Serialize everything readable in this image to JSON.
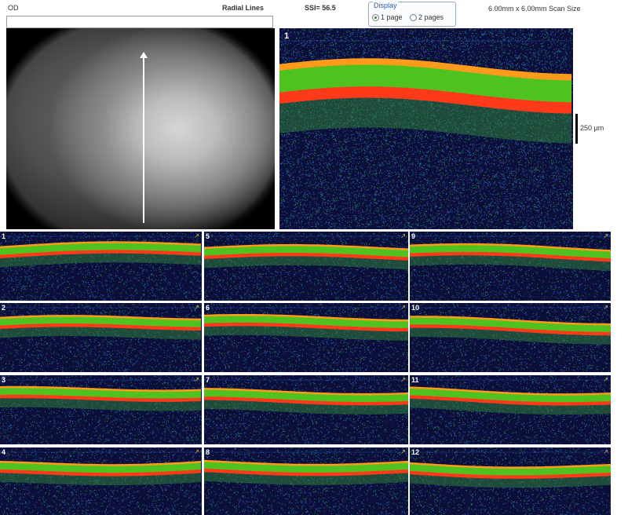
{
  "header": {
    "eye": "OD",
    "scan_type": "Radial Lines",
    "ssi": "SSI= 56.5",
    "scan_size": "6.00mm x 6.00mm Scan Size"
  },
  "display": {
    "legend": "Display",
    "options": [
      {
        "label": "1 page",
        "selected": true
      },
      {
        "label": "2 pages",
        "selected": false
      }
    ]
  },
  "main_scan": {
    "number": "1",
    "scale_label": "250 µm"
  },
  "thumbnails": [
    {
      "number": "1"
    },
    {
      "number": "5"
    },
    {
      "number": "9"
    },
    {
      "number": "2"
    },
    {
      "number": "6"
    },
    {
      "number": "10"
    },
    {
      "number": "3"
    },
    {
      "number": "7"
    },
    {
      "number": "11"
    },
    {
      "number": "4"
    },
    {
      "number": "8"
    },
    {
      "number": "12"
    }
  ],
  "colors": {
    "retina_red": "#ff3a1a",
    "retina_orange": "#ff9a1a",
    "retina_green": "#4fc21f",
    "background_navy": "#0b0f3a"
  }
}
